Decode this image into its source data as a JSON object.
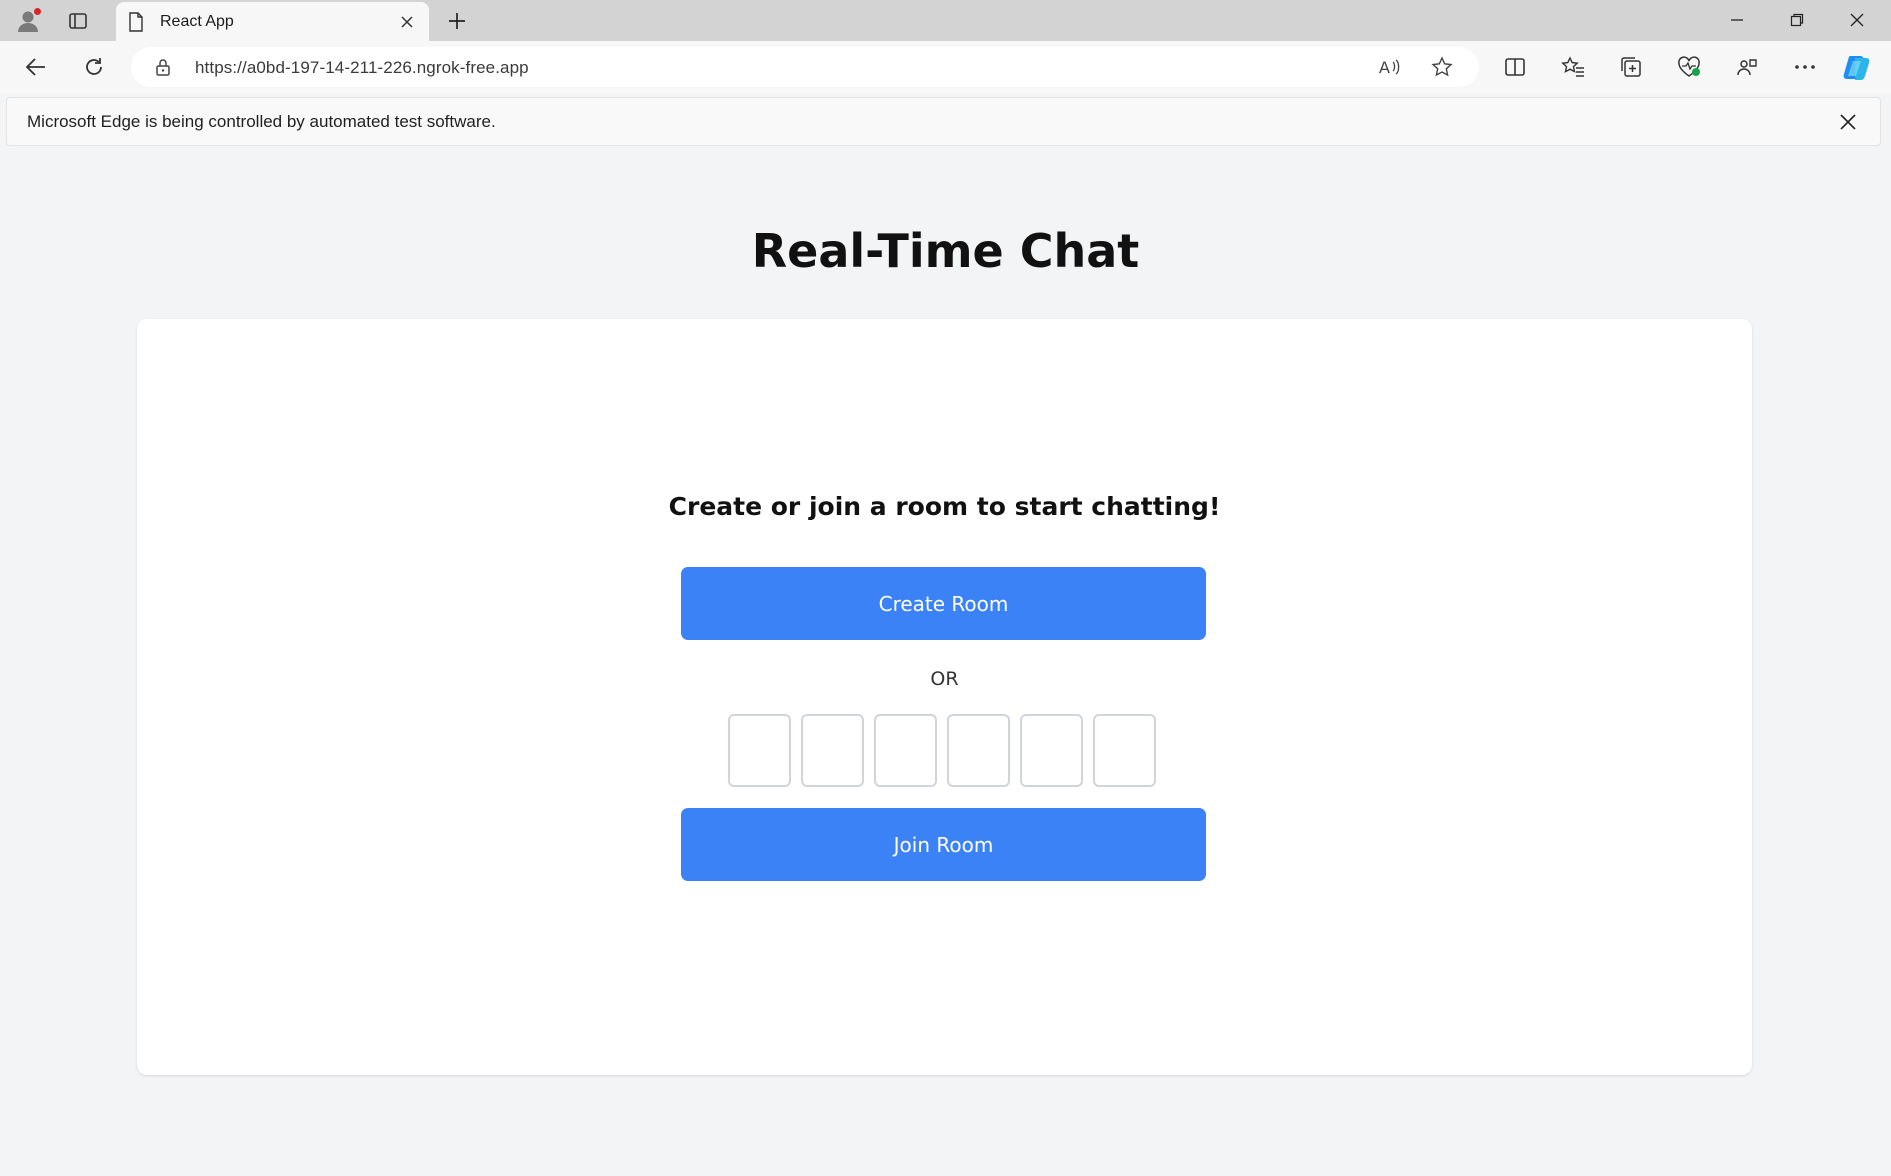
{
  "browser": {
    "tab_title": "React App",
    "url": "https://a0bd-197-14-211-226.ngrok-free.app",
    "infobar_message": "Microsoft Edge is being controlled by automated test software.",
    "colors": {
      "tabstrip": "#d3d3d3",
      "toolbar": "#f7f7f7",
      "accent": "#3b82f6"
    }
  },
  "page": {
    "title": "Real-Time Chat",
    "prompt": "Create or join a room to start chatting!",
    "create_button": "Create Room",
    "or_label": "OR",
    "join_button": "Join Room",
    "room_code": [
      "",
      "",
      "",
      "",
      "",
      ""
    ]
  }
}
